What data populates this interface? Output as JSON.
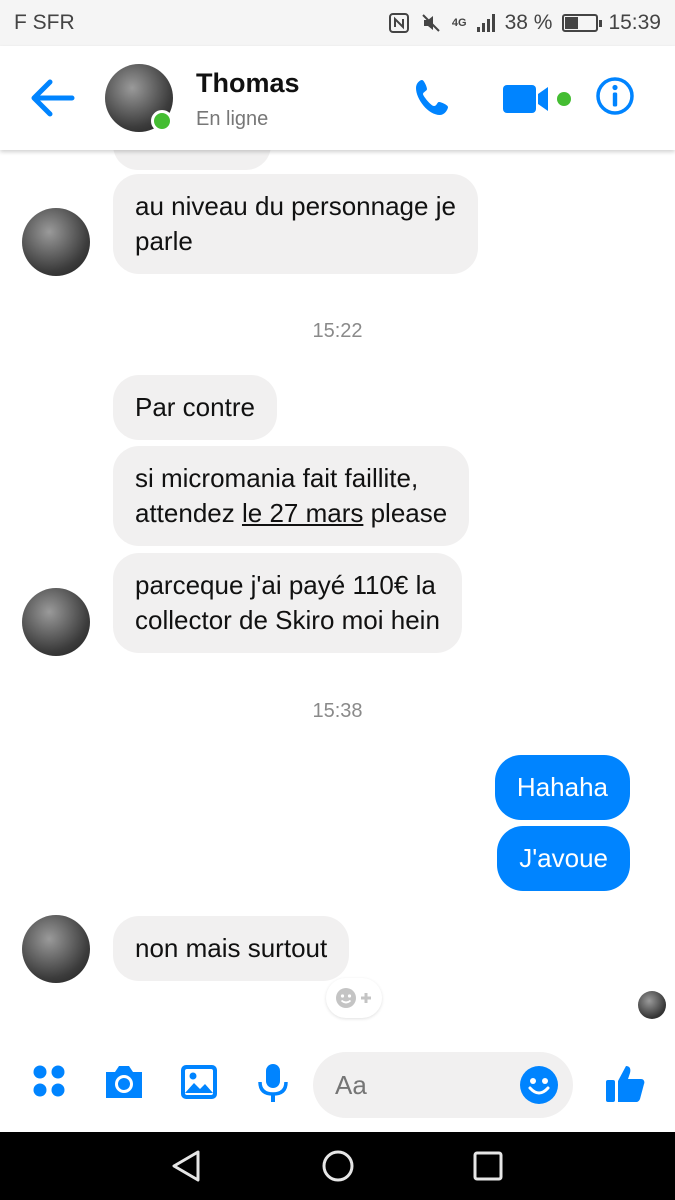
{
  "status_bar": {
    "carrier": "F SFR",
    "network": "4G",
    "battery": "38 %",
    "battery_level": 0.38,
    "time": "15:39"
  },
  "header": {
    "back_icon": "arrow-left-icon",
    "contact_name": "Thomas",
    "contact_status": "En ligne",
    "actions": [
      "phone-icon",
      "video-icon",
      "info-icon"
    ]
  },
  "conversation": {
    "messages": [
      {
        "from": "contact",
        "text": "au niveau du personnage je\nparle"
      },
      {
        "type": "timestamp",
        "text": "15:22"
      },
      {
        "from": "contact",
        "text": "Par contre"
      },
      {
        "from": "contact",
        "text_before": "si micromania fait faillite,\nattendez ",
        "link": "le 27 mars",
        "text_after": " please"
      },
      {
        "from": "contact",
        "text": "parceque j'ai payé 110€ la\ncollector de Skiro moi hein"
      },
      {
        "type": "timestamp",
        "text": "15:38"
      },
      {
        "from": "me",
        "text": "Hahaha"
      },
      {
        "from": "me",
        "text": "J'avoue"
      },
      {
        "from": "contact",
        "text": "non mais surtout"
      }
    ]
  },
  "composer": {
    "placeholder": "Aa",
    "icons": [
      "apps-icon",
      "camera-icon",
      "image-icon",
      "microphone-icon",
      "emoji-icon",
      "thumbs-up-icon"
    ]
  },
  "nav_bar": {
    "buttons": [
      "back-triangle-icon",
      "home-circle-icon",
      "recents-square-icon"
    ]
  },
  "colors": {
    "accent": "#0084ff",
    "received_bubble": "#f1f0f0",
    "online": "#44bd32"
  }
}
